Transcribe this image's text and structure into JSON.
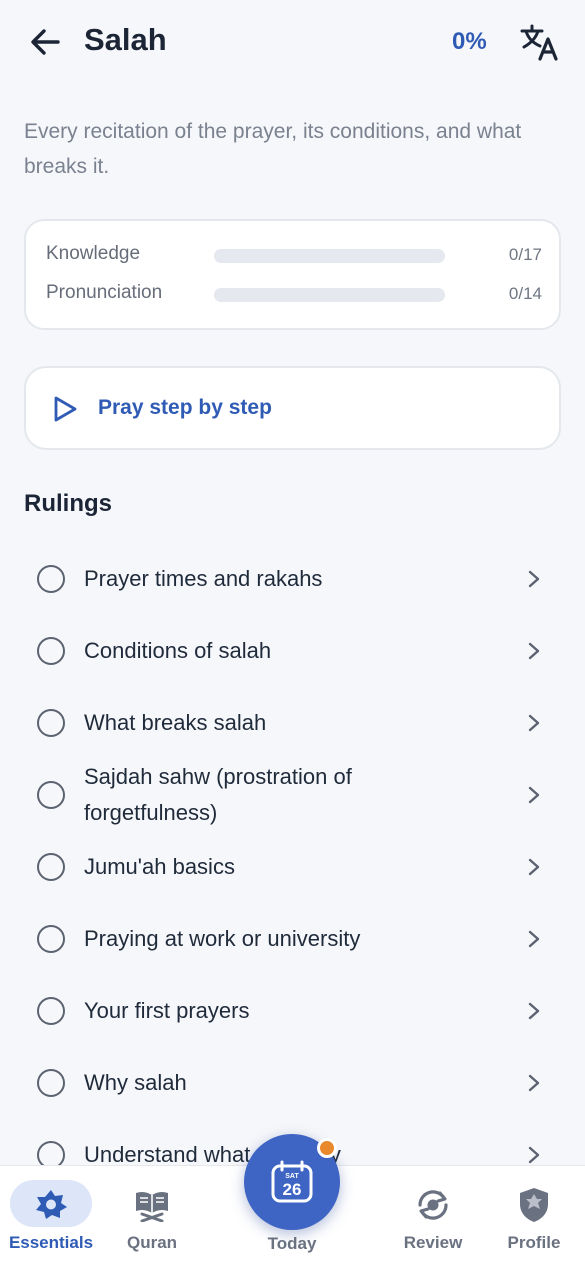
{
  "header": {
    "title": "Salah",
    "percent": "0%",
    "back_icon": "arrow-left-icon",
    "translate_icon": "translate-icon"
  },
  "subtitle": "Every recitation of the prayer, its conditions, and what breaks it.",
  "progress": {
    "rows": [
      {
        "label": "Knowledge",
        "count": "0/17",
        "fraction": 0
      },
      {
        "label": "Pronunciation",
        "count": "0/14",
        "fraction": 0
      }
    ]
  },
  "pray_card": {
    "label": "Pray step by step",
    "icon": "play-icon"
  },
  "rulings": {
    "title": "Rulings",
    "items": [
      {
        "label": "Prayer times and rakahs"
      },
      {
        "label": "Conditions of salah"
      },
      {
        "label": "What breaks salah"
      },
      {
        "label": "Sajdah sahw (prostration of forgetfulness)"
      },
      {
        "label": "Jumu'ah basics"
      },
      {
        "label": "Praying at work or university"
      },
      {
        "label": "Your first prayers"
      },
      {
        "label": "Why salah"
      },
      {
        "label": "Understand what you pray"
      }
    ]
  },
  "nav": {
    "essentials": "Essentials",
    "quran": "Quran",
    "today": "Today",
    "today_day": "SAT",
    "today_date": "26",
    "review": "Review",
    "profile": "Profile"
  },
  "colors": {
    "accent": "#2f5bb5",
    "today_button": "#3e65c3",
    "badge": "#e88a2b",
    "background": "#f6f7fa"
  }
}
